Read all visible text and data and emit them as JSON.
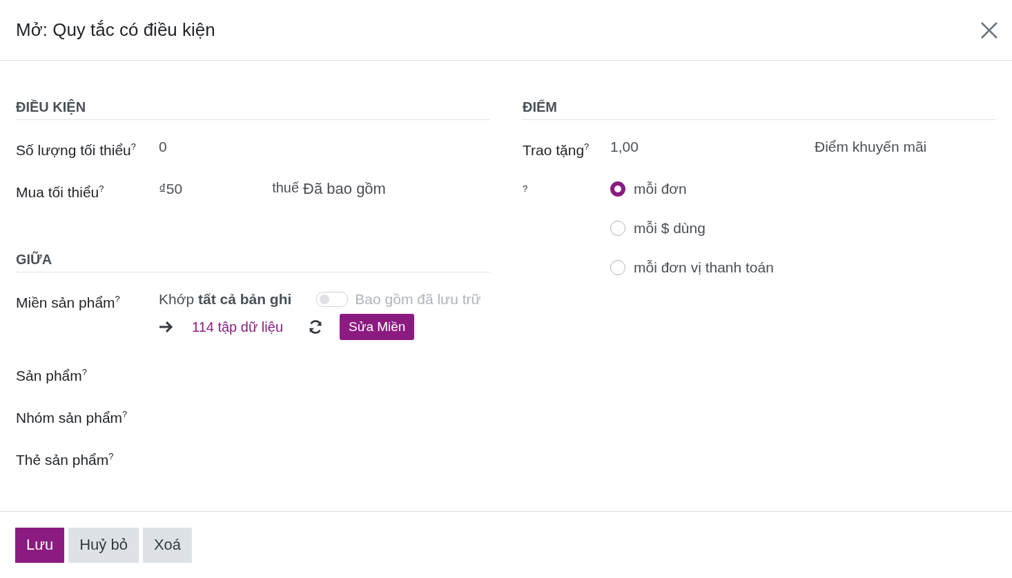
{
  "dialog": {
    "title": "Mở: Quy tắc có điều kiện"
  },
  "conditions": {
    "heading": "ĐIỀU KIỆN",
    "min_quantity": {
      "label": "Số lượng tối thiểu$^{?}$",
      "value": "0"
    },
    "min_purchase": {
      "label": "Mua tối thiểu$^{?}$",
      "value": "₫50",
      "tax_label": "thuế",
      "tax_value": "Đã bao gồm"
    }
  },
  "among": {
    "heading": "GIỮA",
    "domain": {
      "label": "Miền sản phẩm$^{?}$",
      "match": "Khớp **tất cả bản ghi**",
      "archived_toggle": {
        "label": "Bao gồm đã lưu trữ",
        "on": false
      },
      "records_link": "114 tập dữ liệu",
      "edit_button": "Sửa Miền"
    },
    "fields": [
      {
        "label": "Sản phẩm$^{?}$"
      },
      {
        "label": "Nhóm sản phẩm$^{?}$"
      },
      {
        "label": "Thẻ sản phẩm$^{?}$"
      }
    ]
  },
  "points": {
    "heading": "ĐIỂM",
    "grant": {
      "label": "Trao tặng$^{?}$",
      "value": "1,00",
      "unit": "Điểm khuyến mãi"
    },
    "mode": {
      "label": "$^{?}$",
      "options": [
        {
          "label": "mỗi đơn",
          "selected": true
        },
        {
          "label": "mỗi $ dùng",
          "selected": false
        },
        {
          "label": "mỗi đơn vị thanh toán",
          "selected": false
        }
      ]
    }
  },
  "footer": {
    "buttons": [
      {
        "label": "Lưu",
        "kind": "primary"
      },
      {
        "label": "Huỷ bỏ",
        "kind": "secondary"
      },
      {
        "label": "Xoá",
        "kind": "secondary"
      }
    ]
  }
}
